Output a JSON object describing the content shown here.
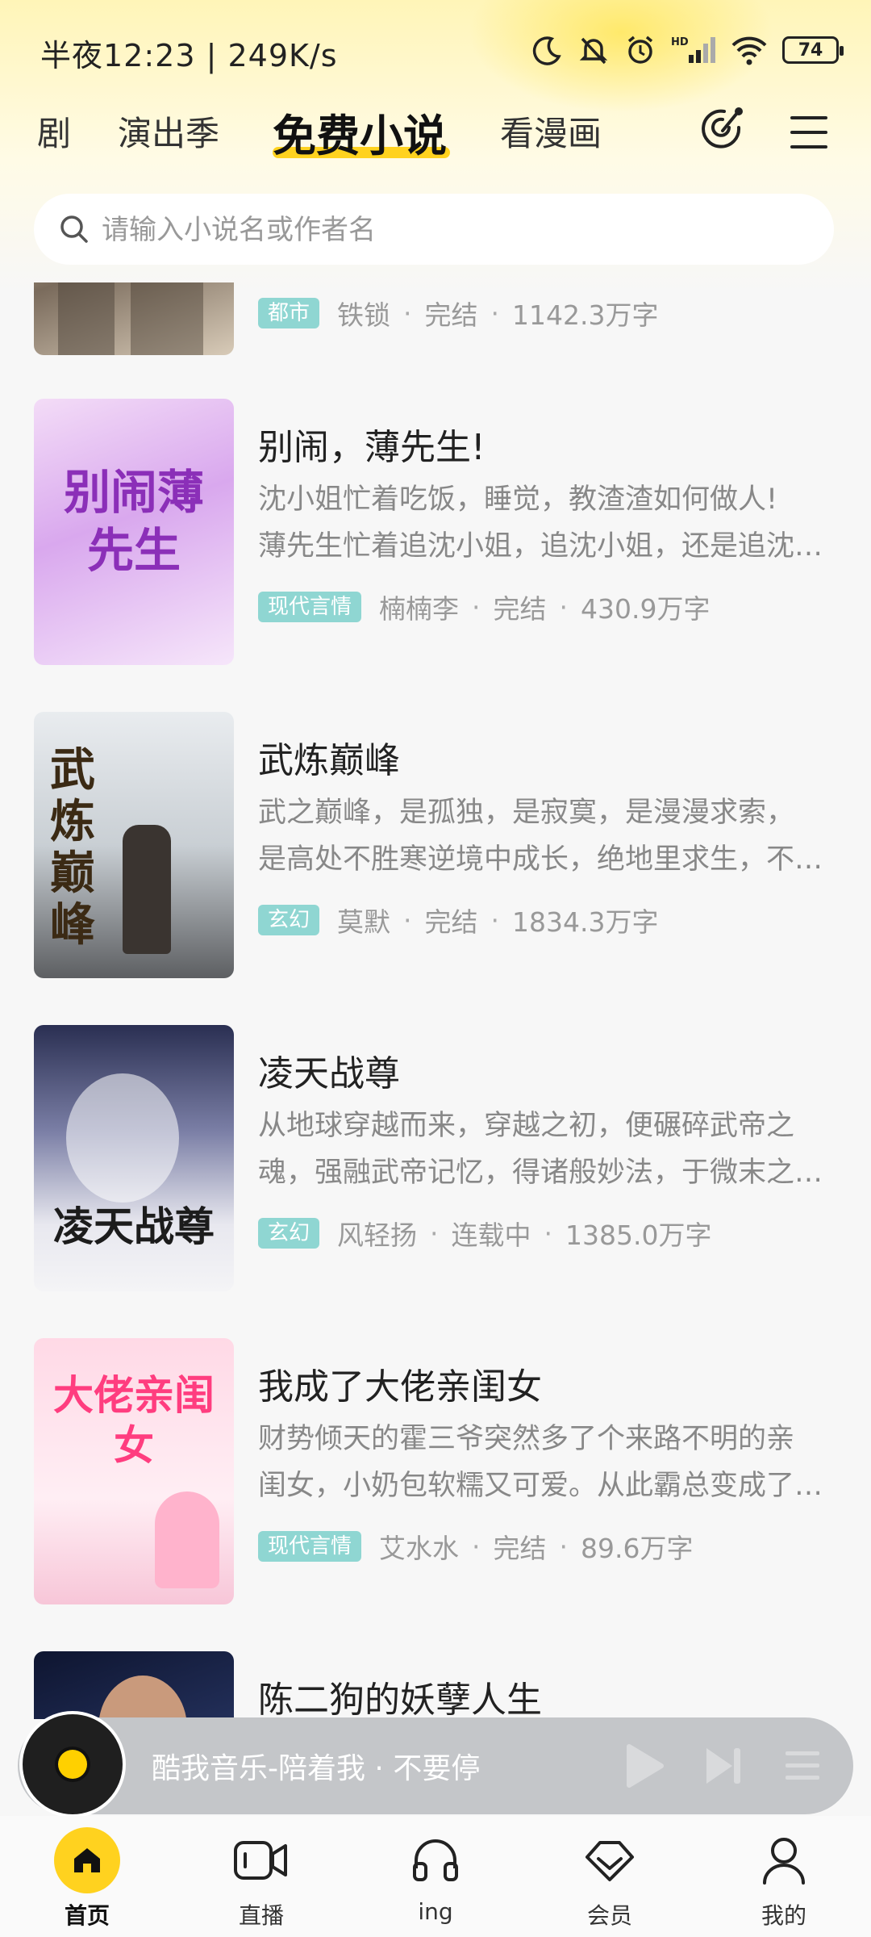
{
  "status": {
    "time": "半夜12:23 | 249K/s",
    "battery": "74"
  },
  "tabs": [
    {
      "label": "剧"
    },
    {
      "label": "演出季"
    },
    {
      "label": "免费小说"
    },
    {
      "label": "看漫画"
    }
  ],
  "search": {
    "placeholder": "请输入小说名或作者名"
  },
  "books": [
    {
      "title": "",
      "desc1": "",
      "desc2": "",
      "tag": "都市",
      "author": "铁锁",
      "status": "完结",
      "words": "1142.3万字"
    },
    {
      "title": "别闹，薄先生!",
      "desc1": "沈小姐忙着吃饭，睡觉，教渣渣如何做人!",
      "desc2": "薄先生忙着追沈小姐，追沈小姐，还是追沈小姐。",
      "tag": "现代言情",
      "author": "楠楠李",
      "status": "完结",
      "words": "430.9万字",
      "cover_text": "别闹薄先生"
    },
    {
      "title": "武炼巅峰",
      "desc1": "武之巅峰，是孤独，是寂寞，是漫漫求索，",
      "desc2": "是高处不胜寒逆境中成长，绝地里求生，不屈不饶。",
      "tag": "玄幻",
      "author": "莫默",
      "status": "完结",
      "words": "1834.3万字",
      "cover_text": "武炼巅峰"
    },
    {
      "title": "凌天战尊",
      "desc1": "从地球穿越而来，穿越之初，便碾碎武帝之",
      "desc2": "魂，强融武帝记忆，得诸般妙法，于微末之中崛起。",
      "tag": "玄幻",
      "author": "风轻扬",
      "status": "连载中",
      "words": "1385.0万字",
      "cover_text": "凌天战尊"
    },
    {
      "title": "我成了大佬亲闺女",
      "desc1": "财势倾天的霍三爷突然多了个来路不明的亲",
      "desc2": "闺女，小奶包软糯又可爱。从此霸总变成了女儿奴。",
      "tag": "现代言情",
      "author": "艾水水",
      "status": "完结",
      "words": "89.6万字",
      "cover_text": "大佬亲闺女"
    },
    {
      "title": "陈二狗的妖孽人生",
      "desc1": "",
      "desc2": "",
      "tag": "",
      "author": "",
      "status": "",
      "words": ""
    }
  ],
  "music": {
    "text": "酷我音乐-陪着我 · 不要停"
  },
  "nav": [
    {
      "label": "首页"
    },
    {
      "label": "直播"
    },
    {
      "label": "ing"
    },
    {
      "label": "会员"
    },
    {
      "label": "我的"
    }
  ],
  "colors": {
    "accent": "#ffd21f",
    "tag": "#8fd6d2"
  }
}
